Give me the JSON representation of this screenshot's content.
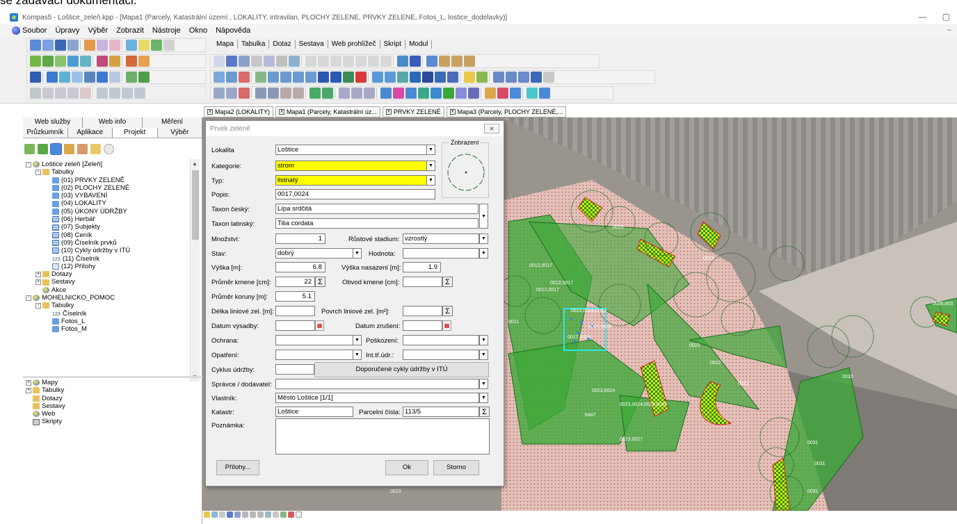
{
  "doc_line": "se zadávací dokumentaci.",
  "window": {
    "title": "Kompas5 - Loštice_zeleň.kpp - [Mapa1 (Parcely, Katastrální území , LOKALITY, intravilan, PLOCHY ZELENÉ, PRVKY ZELENÉ, Fotos_L, lostice_dodelavky)]",
    "minimize": "—",
    "restore": "▢"
  },
  "menu": {
    "items": [
      "Soubor",
      "Úpravy",
      "Výběr",
      "Zobrazit",
      "Nástroje",
      "Okno",
      "Nápověda"
    ],
    "inner_minimize": "–"
  },
  "module_tabs": [
    "Mapa",
    "Tabulka",
    "Dotaz",
    "Sestava",
    "Web prohlížeč",
    "Skript",
    "Modul"
  ],
  "doc_tabs": [
    "Mapa2 (LOKALITY)",
    "Mapa1 (Parcely, Katastrální úz...",
    "PRVKY ZELENÉ",
    "Mapa3 (Parcely, PLOCHY ZELENÉ,..."
  ],
  "left_panel": {
    "tabs_row1": [
      "Web služby",
      "Web info",
      "Měření"
    ],
    "tabs_row2": [
      "Průzkumník",
      "Aplikace",
      "Projekt",
      "Výběr"
    ],
    "active_tab": "Projekt",
    "tree_top": [
      {
        "level": 0,
        "pm": "-",
        "icon": "globe",
        "label": "Loštice zeleň [Zeleň]"
      },
      {
        "level": 1,
        "pm": "-",
        "icon": "folder",
        "label": "Tabulky"
      },
      {
        "level": 2,
        "pm": "",
        "icon": "table",
        "label": "(01) PRVKY ZELENĚ"
      },
      {
        "level": 2,
        "pm": "",
        "icon": "table",
        "label": "(02) PLOCHY ZELENÉ"
      },
      {
        "level": 2,
        "pm": "",
        "icon": "table",
        "label": "(03) VYBAVENÍ"
      },
      {
        "level": 2,
        "pm": "",
        "icon": "table",
        "label": "(04) LOKALITY"
      },
      {
        "level": 2,
        "pm": "",
        "icon": "table",
        "label": "(05) ÚKONY ÚDRŽBY"
      },
      {
        "level": 2,
        "pm": "",
        "icon": "grid",
        "label": "(06) Herbář"
      },
      {
        "level": 2,
        "pm": "",
        "icon": "grid",
        "label": "(07) Subjekty"
      },
      {
        "level": 2,
        "pm": "",
        "icon": "grid",
        "label": "(08) Ceník"
      },
      {
        "level": 2,
        "pm": "",
        "icon": "grid",
        "label": "(09) Číselník prvků"
      },
      {
        "level": 2,
        "pm": "",
        "icon": "grid",
        "label": "(10) Cykly údržby v ITÚ"
      },
      {
        "level": 2,
        "pm": "",
        "icon": "num",
        "label": "(11) Číselník"
      },
      {
        "level": 2,
        "pm": "",
        "icon": "attach",
        "label": "(12) Přílohy"
      },
      {
        "level": 1,
        "pm": "+",
        "icon": "folder",
        "label": "Dotazy"
      },
      {
        "level": 1,
        "pm": "+",
        "icon": "folder",
        "label": "Sestavy"
      },
      {
        "level": 1,
        "pm": "",
        "icon": "globe",
        "label": "Akce"
      },
      {
        "level": 0,
        "pm": "-",
        "icon": "globe",
        "label": "MOHELNICKO_POMOC"
      },
      {
        "level": 1,
        "pm": "-",
        "icon": "folder",
        "label": "Tabulky"
      },
      {
        "level": 2,
        "pm": "",
        "icon": "num",
        "label": "Číselník"
      },
      {
        "level": 2,
        "pm": "",
        "icon": "table",
        "label": "Fotos_L"
      },
      {
        "level": 2,
        "pm": "",
        "icon": "table",
        "label": "Fotos_M"
      }
    ],
    "tree_bottom": [
      {
        "pm": "+",
        "icon": "globe",
        "label": "Mapy"
      },
      {
        "pm": "+",
        "icon": "folder",
        "label": "Tabulky"
      },
      {
        "pm": "",
        "icon": "folder",
        "label": "Dotazy"
      },
      {
        "pm": "",
        "icon": "folder",
        "label": "Sestavy"
      },
      {
        "pm": "",
        "icon": "globe",
        "label": "Web"
      },
      {
        "pm": "",
        "icon": "pc",
        "label": "Skripty"
      }
    ]
  },
  "dialog": {
    "title": "Prvek zeleně",
    "close": "⨯",
    "zobrazeni": "Zobrazení",
    "labels": {
      "lokalita": "Lokalita",
      "kategorie": "Kategorie:",
      "typ": "Typ:",
      "popis": "Popis:",
      "taxon_cesky": "Taxon český:",
      "taxon_latinsky": "Taxon latinský:",
      "mnozstvi": "Množství:",
      "rustove_stadium": "Růstové stadium:",
      "stav": "Stav:",
      "hodnota": "Hodnota:",
      "vyska": "Výška [m]:",
      "vyska_nasazeni": "Výška nasazení [m]:",
      "prumer_kmene": "Průměr kmene [cm]:",
      "obvod_kmene": "Obvod kmene [cm]:",
      "prumer_koruny": "Průměr koruny [m]:",
      "delka_liniove": "Délka liniové zel. [m]:",
      "povrch_liniove": "Povrch liniové zel. [m²]:",
      "datum_vysadby": "Datum výsadby:",
      "datum_zruseni": "Datum zrušení:",
      "ochrana": "Ochrana:",
      "poskozeni": "Poškození:",
      "opatreni": "Opatření:",
      "int_tr_udr": "Int.tř.údr.:",
      "cyklus_udrzby": "Cyklus údržby:",
      "spravce": "Správce / dodavatel:",
      "vlastnik": "Vlastník:",
      "katastr": "Katastr:",
      "parcelni_cisla": "Parcelní čísla:",
      "poznamka": "Poznámka:"
    },
    "values": {
      "lokalita": "Loštice",
      "kategorie": "strom",
      "typ": "listnatý",
      "popis": "0017,0024",
      "taxon_cesky": "Lípa srdčitá",
      "taxon_latinsky": "Tilia cordata",
      "mnozstvi": "1",
      "rustove_stadium": "vzrostlý",
      "stav": "dobrý",
      "hodnota": "",
      "vyska": "6.8",
      "vyska_nasazeni": "1.9",
      "prumer_kmene": "22",
      "obvod_kmene": "",
      "prumer_koruny": "5.1",
      "delka_liniove": "",
      "povrch_liniove": "",
      "datum_vysadby": "",
      "datum_zruseni": "",
      "ochrana": "",
      "poskozeni": "",
      "opatreni": "",
      "int_tr_udr": "",
      "cyklus_udrzby": "",
      "spravce": "",
      "vlastnik": "Město Loštice [1/1]",
      "katastr": "Loštice",
      "parcelni_cisla": "113/5",
      "poznamka": ""
    },
    "buttons": {
      "doporucene": "Doporučené cykly údržby v ITÚ",
      "prilohy": "Přílohy...",
      "ok": "Ok",
      "storno": "Storno"
    },
    "glyphs": {
      "dropdown": "▼",
      "sigma": "Σ",
      "calendar": "▦"
    }
  },
  "map_labels": [
    "0012,0017",
    "0012,0017",
    "0012,0017",
    "0012,0016,0024",
    "0017,0024",
    "0017,0024",
    "0015",
    "0019",
    "0022",
    "0022",
    "0022",
    "0023,0024",
    "0023,0024,0025,0028",
    "0023,0027",
    "foto7",
    "0031",
    "0031",
    "0031",
    "0033",
    "0035,003",
    "0023",
    "0011",
    "0012"
  ],
  "colors": {
    "accent_yellow": "#ffff00",
    "map_green": "#3fa83a",
    "map_pink": "#e8b8b0",
    "selection_cyan": "#2ee6e6"
  }
}
